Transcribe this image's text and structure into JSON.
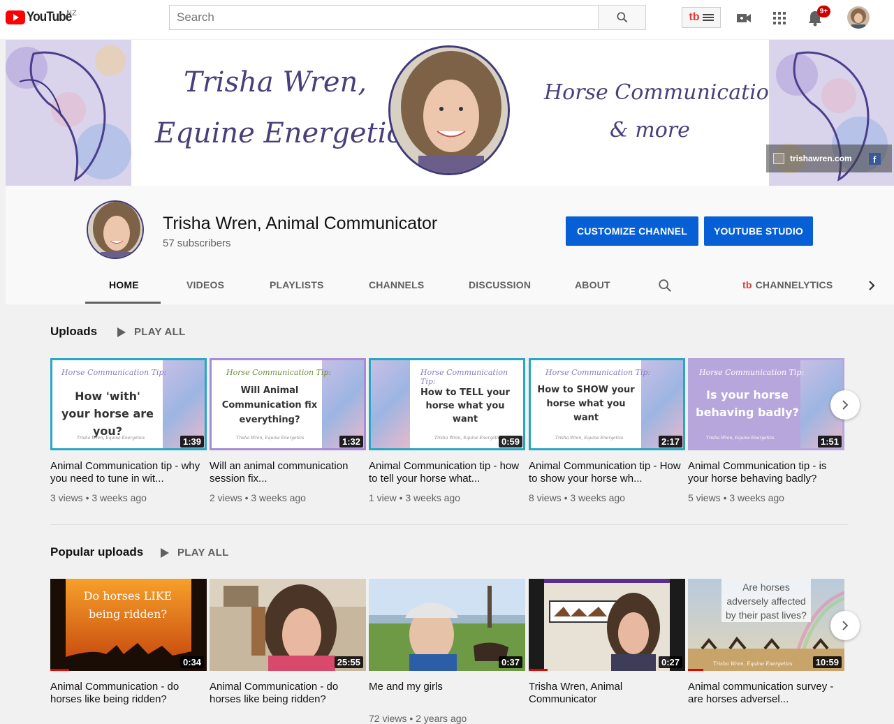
{
  "masthead": {
    "logo_text": "YouTube",
    "country_code": "NZ",
    "search_placeholder": "Search",
    "notification_count": "9+"
  },
  "banner": {
    "title_line1": "Trisha Wren,",
    "title_line2": "Equine Energetics",
    "tagline_line1": "Horse Communication",
    "tagline_line2": "& more",
    "link_text": "trishawren.com",
    "facebook_glyph": "f"
  },
  "channel": {
    "name": "Trisha Wren, Animal Communicator",
    "subscribers": "57 subscribers",
    "customize_label": "CUSTOMIZE CHANNEL",
    "studio_label": "YOUTUBE STUDIO"
  },
  "tabs": [
    {
      "label": "HOME",
      "active": true
    },
    {
      "label": "VIDEOS"
    },
    {
      "label": "PLAYLISTS"
    },
    {
      "label": "CHANNELS"
    },
    {
      "label": "DISCUSSION"
    },
    {
      "label": "ABOUT"
    }
  ],
  "channelytics_label": "CHANNELYTICS",
  "uploads": {
    "title": "Uploads",
    "play_all": "PLAY ALL",
    "videos": [
      {
        "thumb_head": "Horse Communication Tip:",
        "thumb_text": "How 'with' your horse are you?",
        "thumb_foot": "Trisha Wren, Equine Energetics",
        "duration": "1:39",
        "title": "Animal Communication tip - why you need to tune in wit...",
        "meta": "3 views • 3 weeks ago",
        "color": "#2aa6c2"
      },
      {
        "thumb_head": "Horse Communication Tip:",
        "thumb_text": "Will Animal Communication fix everything?",
        "thumb_foot": "Trisha Wren, Equine Energetics",
        "duration": "1:32",
        "title": "Will an animal communication session fix...",
        "meta": "2 views • 3 weeks ago",
        "color": "#a68bd6"
      },
      {
        "thumb_head": "Horse Communication Tip:",
        "thumb_text": "How to TELL your horse what you want",
        "thumb_foot": "Trisha Wren, Equine Energetics",
        "duration": "0:59",
        "title": "Animal Communication tip - how to tell your horse what...",
        "meta": "1 view • 3 weeks ago",
        "color": "#2aa6c2"
      },
      {
        "thumb_head": "Horse Communication Tip:",
        "thumb_text": "How to SHOW your horse what you want",
        "thumb_foot": "Trisha Wren, Equine Energetics",
        "duration": "2:17",
        "title": "Animal Communication tip - How to show your horse wh...",
        "meta": "8 views • 3 weeks ago",
        "color": "#2aa6c2"
      },
      {
        "thumb_head": "Horse Communication Tip:",
        "thumb_text": "Is your horse behaving badly?",
        "thumb_foot": "Trisha Wren, Equine Energetics",
        "duration": "1:51",
        "title": "Animal Communication tip - is your horse behaving badly?",
        "meta": "5 views • 3 weeks ago",
        "color": "#a68bd6"
      }
    ]
  },
  "popular": {
    "title": "Popular uploads",
    "play_all": "PLAY ALL",
    "videos": [
      {
        "thumb_text": "Do horses LIKE being ridden?",
        "duration": "0:34",
        "title": "Animal Communication - do horses like being ridden?",
        "meta": "",
        "progress": 0.12
      },
      {
        "thumb_text": "",
        "duration": "25:55",
        "title": "Animal Communication - do horses like being ridden?",
        "meta": "",
        "progress": 0
      },
      {
        "thumb_text": "",
        "duration": "0:37",
        "title": "Me and my girls",
        "meta": "72 views • 2 years ago",
        "progress": 0
      },
      {
        "thumb_text": "",
        "duration": "0:27",
        "title": "Trisha Wren, Animal Communicator",
        "meta": "",
        "progress": 0.12
      },
      {
        "thumb_text": "Are horses adversely affected by their past lives?",
        "thumb_foot": "Trisha Wren, Equine Energetics",
        "duration": "10:59",
        "title": "Animal communication survey - are horses adversel...",
        "meta": "",
        "progress": 0.1
      }
    ]
  }
}
